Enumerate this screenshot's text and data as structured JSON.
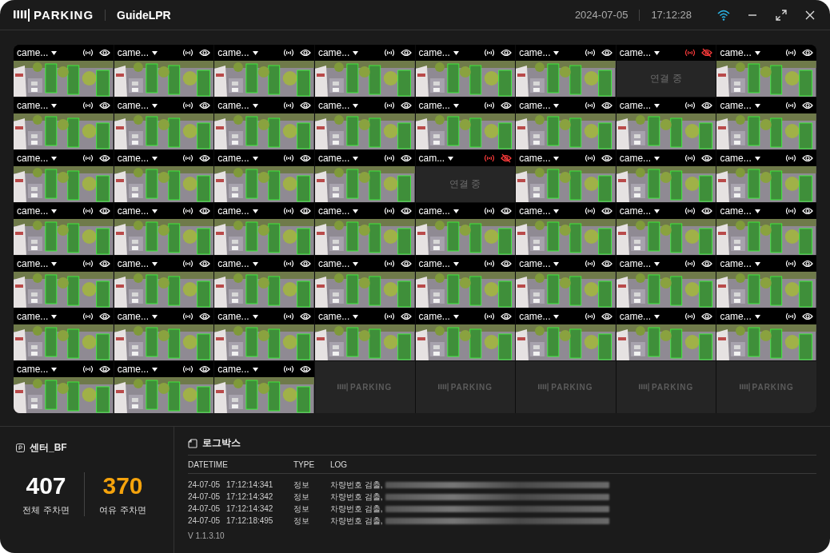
{
  "header": {
    "logo": "PARKING",
    "app_name": "GuideLPR",
    "date": "2024-07-05",
    "time": "17:12:28"
  },
  "cameras": [
    {
      "kind": "live",
      "label": "came..."
    },
    {
      "kind": "live",
      "label": "came..."
    },
    {
      "kind": "live",
      "label": "came..."
    },
    {
      "kind": "live",
      "label": "came..."
    },
    {
      "kind": "live",
      "label": "came..."
    },
    {
      "kind": "live",
      "label": "came..."
    },
    {
      "kind": "connecting",
      "label": "came...",
      "message": "연결 중"
    },
    {
      "kind": "live",
      "label": "came..."
    },
    {
      "kind": "live",
      "label": "came..."
    },
    {
      "kind": "live",
      "label": "came..."
    },
    {
      "kind": "live",
      "label": "came..."
    },
    {
      "kind": "live",
      "label": "came..."
    },
    {
      "kind": "live",
      "label": "came..."
    },
    {
      "kind": "live",
      "label": "came..."
    },
    {
      "kind": "live",
      "label": "came..."
    },
    {
      "kind": "live",
      "label": "came..."
    },
    {
      "kind": "live",
      "label": "came..."
    },
    {
      "kind": "live",
      "label": "came..."
    },
    {
      "kind": "live",
      "label": "came..."
    },
    {
      "kind": "live",
      "label": "came..."
    },
    {
      "kind": "connecting",
      "label": "cam...",
      "message": "연결 중"
    },
    {
      "kind": "live",
      "label": "came..."
    },
    {
      "kind": "live",
      "label": "came..."
    },
    {
      "kind": "live",
      "label": "came..."
    },
    {
      "kind": "live",
      "label": "came..."
    },
    {
      "kind": "live",
      "label": "came..."
    },
    {
      "kind": "live",
      "label": "came..."
    },
    {
      "kind": "live",
      "label": "came..."
    },
    {
      "kind": "live",
      "label": "came..."
    },
    {
      "kind": "live",
      "label": "came..."
    },
    {
      "kind": "live",
      "label": "came..."
    },
    {
      "kind": "live",
      "label": "came..."
    },
    {
      "kind": "live",
      "label": "came..."
    },
    {
      "kind": "live",
      "label": "came..."
    },
    {
      "kind": "live",
      "label": "came..."
    },
    {
      "kind": "live",
      "label": "came..."
    },
    {
      "kind": "live",
      "label": "came..."
    },
    {
      "kind": "live",
      "label": "came..."
    },
    {
      "kind": "live",
      "label": "came..."
    },
    {
      "kind": "live",
      "label": "came..."
    },
    {
      "kind": "live",
      "label": "came..."
    },
    {
      "kind": "live",
      "label": "came..."
    },
    {
      "kind": "live",
      "label": "came..."
    },
    {
      "kind": "live",
      "label": "came..."
    },
    {
      "kind": "live",
      "label": "came..."
    },
    {
      "kind": "live",
      "label": "came..."
    },
    {
      "kind": "live",
      "label": "came..."
    },
    {
      "kind": "live",
      "label": "came..."
    },
    {
      "kind": "live",
      "label": "came..."
    },
    {
      "kind": "live",
      "label": "came..."
    },
    {
      "kind": "live",
      "label": "came..."
    },
    {
      "kind": "empty",
      "logo": "PARKING"
    },
    {
      "kind": "empty",
      "logo": "PARKING"
    },
    {
      "kind": "empty",
      "logo": "PARKING"
    },
    {
      "kind": "empty",
      "logo": "PARKING"
    },
    {
      "kind": "empty",
      "logo": "PARKING"
    }
  ],
  "summary": {
    "zone": "센터_BF",
    "total": "407",
    "total_label": "전체 주차면",
    "free": "370",
    "free_label": "여유 주차면"
  },
  "logbox": {
    "title": "로그박스",
    "columns": [
      "DATETIME",
      "TYPE",
      "LOG"
    ],
    "rows": [
      {
        "date": "24-07-05",
        "time": "17:12:14:341",
        "type": "정보",
        "log": "차량번호 검출,"
      },
      {
        "date": "24-07-05",
        "time": "17:12:14:342",
        "type": "정보",
        "log": "차량번호 검출,"
      },
      {
        "date": "24-07-05",
        "time": "17:12:14:342",
        "type": "정보",
        "log": "차량번호 검출,"
      },
      {
        "date": "24-07-05",
        "time": "17:12:18:495",
        "type": "정보",
        "log": "차량번호 검출,"
      }
    ]
  },
  "version": "V 1.1.3.10"
}
